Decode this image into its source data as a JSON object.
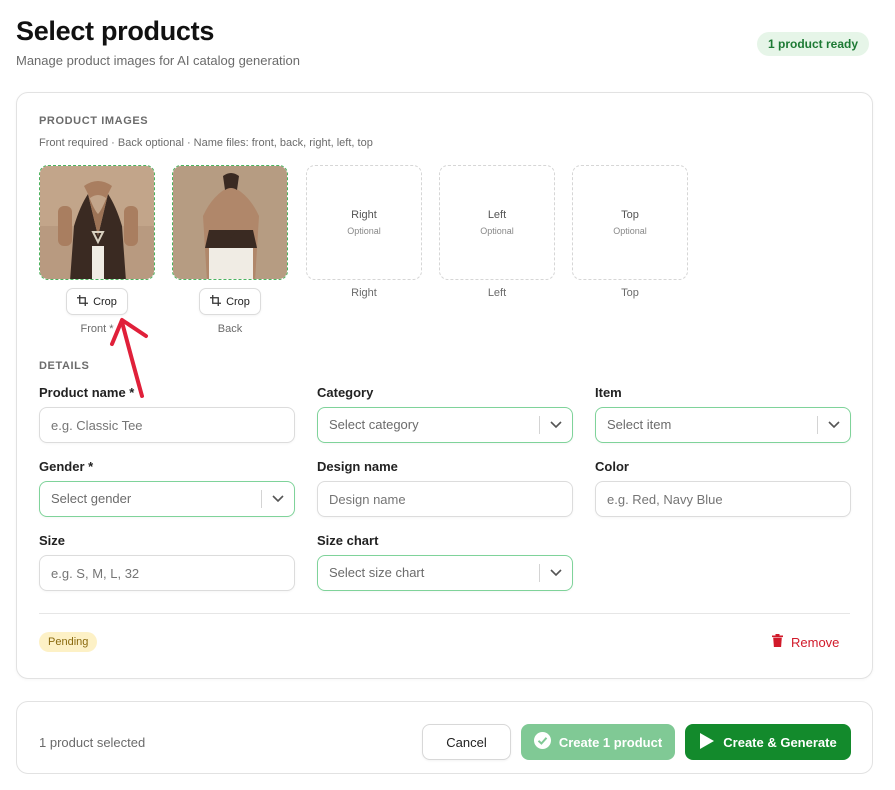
{
  "header": {
    "title": "Select products",
    "subtitle": "Manage product images for AI catalog generation",
    "ready_badge": "1 product ready"
  },
  "images": {
    "section_label": "PRODUCT IMAGES",
    "hint": "Front required · Back optional · Name files: front, back, right, left, top",
    "crop_label": "Crop",
    "slots": [
      {
        "caption": "Front *",
        "state": "filled"
      },
      {
        "caption": "Back",
        "state": "filled"
      },
      {
        "caption": "Right",
        "title": "Right",
        "sub": "Optional",
        "state": "empty"
      },
      {
        "caption": "Left",
        "title": "Left",
        "sub": "Optional",
        "state": "empty"
      },
      {
        "caption": "Top",
        "title": "Top",
        "sub": "Optional",
        "state": "empty"
      }
    ]
  },
  "details": {
    "section_label": "DETAILS",
    "product_name": {
      "label": "Product name *",
      "placeholder": "e.g. Classic Tee"
    },
    "category": {
      "label": "Category",
      "value": "Select category"
    },
    "item": {
      "label": "Item",
      "value": "Select item"
    },
    "gender": {
      "label": "Gender *",
      "value": "Select gender"
    },
    "design_name": {
      "label": "Design name",
      "placeholder": "Design name"
    },
    "color": {
      "label": "Color",
      "placeholder": "e.g. Red, Navy Blue"
    },
    "size": {
      "label": "Size",
      "placeholder": "e.g. S, M, L, 32"
    },
    "size_chart": {
      "label": "Size chart",
      "value": "Select size chart"
    }
  },
  "status": {
    "pending_label": "Pending",
    "remove_label": "Remove"
  },
  "footer": {
    "selected_count": "1 product selected",
    "cancel_label": "Cancel",
    "create_label": "Create 1 product",
    "generate_label": "Create & Generate"
  },
  "colors": {
    "accent_green": "#138a2c",
    "disabled_green": "#80c995",
    "danger_red": "#d11a2a",
    "annotation_red": "#e0203a"
  },
  "icons": [
    "crop-icon",
    "chevron-down-icon",
    "trash-icon",
    "check-circle-icon",
    "play-icon"
  ]
}
